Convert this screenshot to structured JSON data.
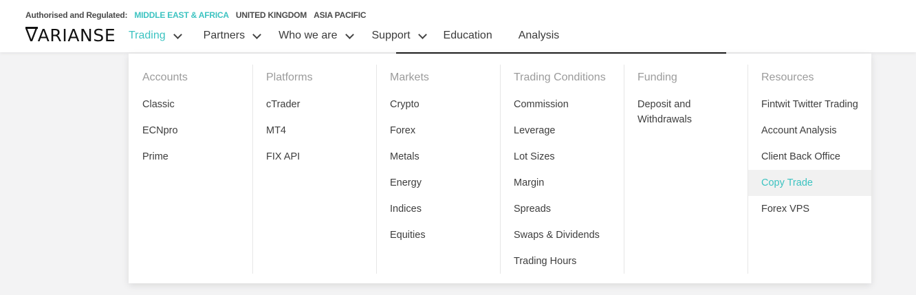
{
  "regulation": {
    "label": "Authorised and Regulated:",
    "regions": [
      {
        "label": "MIDDLE EAST & AFRICA",
        "active": true
      },
      {
        "label": "UNITED KINGDOM",
        "active": false
      },
      {
        "label": "ASIA PACIFIC",
        "active": false
      }
    ]
  },
  "logo": {
    "first": "V",
    "rest": "ARIANSE"
  },
  "nav": {
    "items": [
      {
        "label": "Trading",
        "dropdown": true,
        "active": true
      },
      {
        "label": "Partners",
        "dropdown": true,
        "active": false
      },
      {
        "label": "Who we are",
        "dropdown": true,
        "active": false
      },
      {
        "label": "Support",
        "dropdown": true,
        "active": false
      },
      {
        "label": "Education",
        "dropdown": false,
        "active": false
      },
      {
        "label": "Analysis",
        "dropdown": false,
        "active": false
      }
    ]
  },
  "accent_color": "#3cc3c1",
  "dropdown": {
    "columns": [
      {
        "title": "Accounts",
        "items": [
          "Classic",
          "ECNpro",
          "Prime"
        ]
      },
      {
        "title": "Platforms",
        "items": [
          "cTrader",
          "MT4",
          "FIX API"
        ]
      },
      {
        "title": "Markets",
        "items": [
          "Crypto",
          "Forex",
          "Metals",
          "Energy",
          "Indices",
          "Equities"
        ]
      },
      {
        "title": "Trading Conditions",
        "items": [
          "Commission",
          "Leverage",
          "Lot Sizes",
          "Margin",
          "Spreads",
          "Swaps & Dividends",
          "Trading Hours"
        ]
      },
      {
        "title": "Funding",
        "items": [
          "Deposit and Withdrawals"
        ]
      },
      {
        "title": "Resources",
        "items": [
          "Fintwit Twitter Trading",
          "Account Analysis",
          "Client Back Office",
          "Copy Trade",
          "Forex VPS"
        ],
        "highlighted": "Copy Trade"
      }
    ]
  }
}
